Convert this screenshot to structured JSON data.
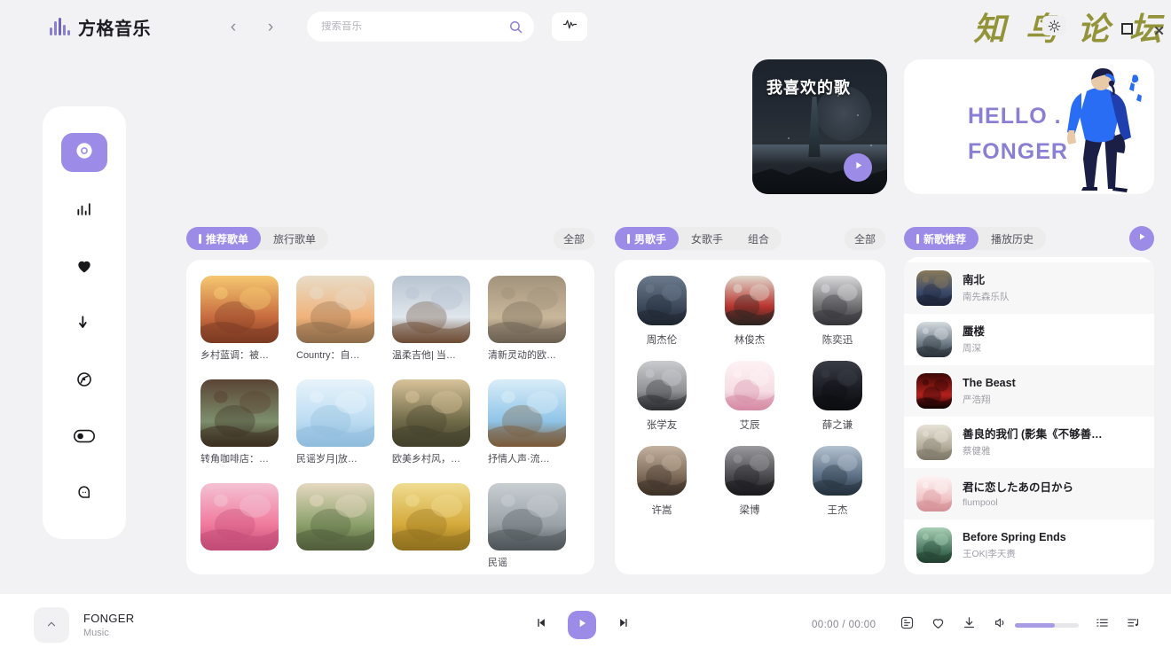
{
  "app": {
    "brand_name": "方格音乐",
    "watermark": "知 鸟 论 坛"
  },
  "topbar": {
    "back_icon": "‹",
    "forward_icon": "›",
    "search_placeholder": "搜索音乐",
    "search_value": "",
    "search_icon": "search-icon",
    "equalizer_icon": "equalizer-icon"
  },
  "sidebar": {
    "items": [
      {
        "name": "disc",
        "icon": "disc-icon",
        "active": true
      },
      {
        "name": "charts",
        "icon": "bar-chart-icon",
        "active": false
      },
      {
        "name": "favorites",
        "icon": "heart-icon",
        "active": false
      },
      {
        "name": "downloads",
        "icon": "download-arrow-icon",
        "active": false
      },
      {
        "name": "radar",
        "icon": "compass-icon",
        "active": false
      },
      {
        "name": "toggle",
        "icon": "toggle-icon",
        "active": false
      },
      {
        "name": "chat",
        "icon": "speech-bubble-icon",
        "active": false
      }
    ]
  },
  "hero": {
    "favorite_card": {
      "title": "我喜欢的歌",
      "play_icon": "play-icon"
    },
    "hello_card": {
      "line1": "HELLO .",
      "line2": "FONGER"
    }
  },
  "playlists_panel": {
    "tabs": [
      {
        "label": "推荐歌单",
        "active": true
      },
      {
        "label": "旅行歌单",
        "active": false
      }
    ],
    "all_label": "全部",
    "items": [
      {
        "title": "乡村蓝调：被…",
        "c1": "#c76b3f",
        "c2": "#f6c871",
        "c3": "#7b3a22",
        "art": "moon"
      },
      {
        "title": "Country：自…",
        "c1": "#f0b27a",
        "c2": "#e8dcc8",
        "c3": "#8e6b4a",
        "art": "road"
      },
      {
        "title": "温柔吉他| 当…",
        "c1": "#dfe6ec",
        "c2": "#b8c4d2",
        "c3": "#6d4b33",
        "art": "guitar"
      },
      {
        "title": "清新灵动的欧…",
        "c1": "#c9b79a",
        "c2": "#a2937c",
        "c3": "#6c6052",
        "art": "field"
      },
      {
        "title": "转角咖啡店：…",
        "c1": "#7d8f6c",
        "c2": "#5a4434",
        "c3": "#3b2d20",
        "art": "cafe"
      },
      {
        "title": "民谣岁月|放…",
        "c1": "#bcdcf2",
        "c2": "#e7f3fb",
        "c3": "#8fbcdc",
        "art": "ferris"
      },
      {
        "title": "欧美乡村风，…",
        "c1": "#6f6a48",
        "c2": "#d8c39a",
        "c3": "#42402c",
        "art": "flower"
      },
      {
        "title": "抒情人声·流…",
        "c1": "#8fc4e8",
        "c2": "#d9edf8",
        "c3": "#7a5a38",
        "art": "sofa"
      },
      {
        "title": "",
        "c1": "#f07a9c",
        "c2": "#f4c2d4",
        "c3": "#c14a76",
        "art": "flamingo"
      },
      {
        "title": "",
        "c1": "#8aa06a",
        "c2": "#e6d9c0",
        "c3": "#4f5e3a",
        "art": "blonde"
      },
      {
        "title": "",
        "c1": "#d4a93a",
        "c2": "#f0dc92",
        "c3": "#8f6f1e",
        "art": "wheat"
      },
      {
        "title": "民谣",
        "c1": "#9aa2a8",
        "c2": "#c8ced2",
        "c3": "#4d5458",
        "art": "busker"
      }
    ]
  },
  "singers_panel": {
    "tabs": [
      {
        "label": "男歌手",
        "active": true
      },
      {
        "label": "女歌手",
        "active": false
      },
      {
        "label": "组合",
        "active": false
      }
    ],
    "all_label": "全部",
    "items": [
      {
        "name": "周杰伦",
        "c1": "#3d4a5c",
        "c2": "#6b7a8c",
        "c3": "#1e2530"
      },
      {
        "name": "林俊杰",
        "c1": "#b8342f",
        "c2": "#e0d8cc",
        "c3": "#2a2420"
      },
      {
        "name": "陈奕迅",
        "c1": "#6f6f72",
        "c2": "#d9d9dc",
        "c3": "#35353a"
      },
      {
        "name": "张学友",
        "c1": "#8e9094",
        "c2": "#c9cbcf",
        "c3": "#2b2d31"
      },
      {
        "name": "艾辰",
        "c1": "#f6dde4",
        "c2": "#fdf2f5",
        "c3": "#d58aa4"
      },
      {
        "name": "薛之谦",
        "c1": "#181a20",
        "c2": "#3a3d46",
        "c3": "#0c0d11"
      },
      {
        "name": "许嵩",
        "c1": "#7d6a58",
        "c2": "#c4b2a0",
        "c3": "#3b2f26"
      },
      {
        "name": "梁博",
        "c1": "#4a4a4e",
        "c2": "#9a9a9e",
        "c3": "#1a1a1d"
      },
      {
        "name": "王杰",
        "c1": "#5a6e84",
        "c2": "#b4c2d0",
        "c3": "#24303c"
      }
    ]
  },
  "songs_panel": {
    "tabs": [
      {
        "label": "新歌推荐",
        "active": true
      },
      {
        "label": "播放历史",
        "active": false
      }
    ],
    "play_icon": "play-icon",
    "items": [
      {
        "title": "南北",
        "artist": "南先森乐队",
        "c1": "#3a4a6a",
        "c2": "#8a7a5a",
        "c3": "#1c2236"
      },
      {
        "title": "蜃楼",
        "artist": "周深",
        "c1": "#6d7a84",
        "c2": "#d6dde2",
        "c3": "#2a3138"
      },
      {
        "title": "The Beast",
        "artist": "严浩翔",
        "c1": "#b4201c",
        "c2": "#3a0806",
        "c3": "#120202"
      },
      {
        "title": "善良的我们 (影集《不够善…",
        "artist": "蔡健雅",
        "c1": "#b5ae9c",
        "c2": "#e6e2d6",
        "c3": "#7d786a"
      },
      {
        "title": "君に恋したあの日から",
        "artist": "flumpool",
        "c1": "#f2c6c8",
        "c2": "#fdf4f4",
        "c3": "#d49096"
      },
      {
        "title": "Before Spring Ends",
        "artist": "王OK|李天赉",
        "c1": "#4d7a62",
        "c2": "#a8cfb6",
        "c3": "#22402f"
      }
    ]
  },
  "player": {
    "expand_icon": "chevron-up-icon",
    "track_title": "FONGER",
    "track_sub": "Music",
    "prev_icon": "previous-icon",
    "play_icon": "play-icon",
    "next_icon": "next-icon",
    "time_current": "00:00",
    "time_separator": "/",
    "time_total": "00:00",
    "right_icons": [
      "lyrics-icon",
      "heart-icon",
      "download-icon",
      "volume-icon",
      "list-icon",
      "queue-icon"
    ],
    "volume_percent": 62
  },
  "colors": {
    "accent_purple": "#9c8ce8",
    "brand_purple": "#8b7fd4",
    "page_bg": "#f2f2f4",
    "panel_bg": "#ffffff",
    "watermark": "#8b8b2b"
  }
}
